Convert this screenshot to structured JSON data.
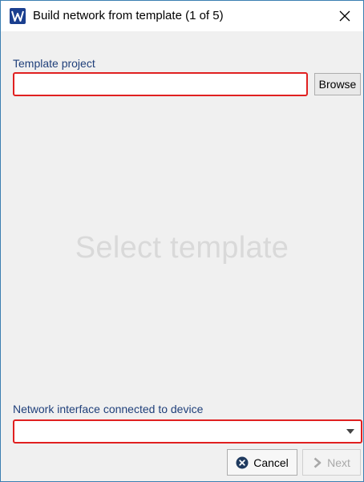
{
  "window": {
    "title": "Build network from template (1 of 5)",
    "app_icon": "app-logo-icon",
    "close_icon": "close-icon"
  },
  "template": {
    "label": "Template project",
    "value": "",
    "browse_label": "Browse"
  },
  "placeholder": {
    "text": "Select template"
  },
  "network": {
    "label": "Network interface connected to device",
    "selected_value": ""
  },
  "buttons": {
    "cancel_label": "Cancel",
    "cancel_icon": "cancel-circle-icon",
    "next_label": "Next",
    "next_icon": "chevron-right-icon",
    "next_enabled": false
  },
  "colors": {
    "error_border": "#e02020",
    "label_text": "#1f3f7a",
    "placeholder_text": "#d9d9d9",
    "window_border": "#3c7fb1",
    "app_icon_bg": "#1b3f8f"
  }
}
